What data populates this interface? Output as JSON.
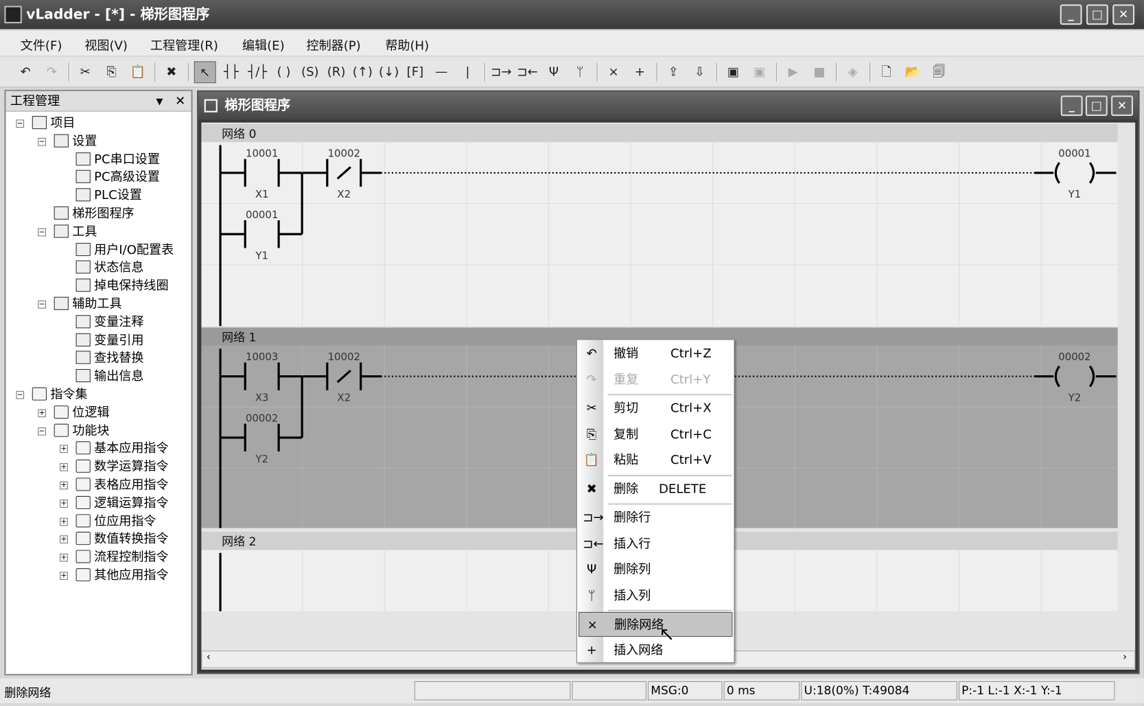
{
  "window": {
    "title": "vLadder - [*] - 梯形图程序",
    "min": "_",
    "max": "□",
    "close": "✕"
  },
  "menu": [
    "文件(F)",
    "视图(V)",
    "工程管理(R)",
    "编辑(E)",
    "控制器(P)",
    "帮助(H)"
  ],
  "toolbar": [
    {
      "name": "undo",
      "g": "↶"
    },
    {
      "name": "redo",
      "g": "↷",
      "dis": true
    },
    "sep",
    {
      "name": "cut",
      "g": "✂"
    },
    {
      "name": "copy",
      "g": "⎘"
    },
    {
      "name": "paste",
      "g": "📋"
    },
    "sep",
    {
      "name": "delete",
      "g": "✖"
    },
    "sep",
    {
      "name": "select",
      "g": "↖",
      "sel": true
    },
    {
      "name": "contact-no",
      "g": "┤├"
    },
    {
      "name": "contact-nc",
      "g": "┤/├"
    },
    {
      "name": "coil",
      "g": "( )"
    },
    {
      "name": "set-coil",
      "g": "(S)"
    },
    {
      "name": "reset-coil",
      "g": "(R)"
    },
    {
      "name": "pulse-up",
      "g": "(↑)"
    },
    {
      "name": "pulse-down",
      "g": "(↓)"
    },
    {
      "name": "function-block",
      "g": "[F]"
    },
    {
      "name": "horizontal-line",
      "g": "—"
    },
    {
      "name": "vertical-line",
      "g": "|"
    },
    "sep",
    {
      "name": "delete-row",
      "g": "⊐→"
    },
    {
      "name": "insert-row",
      "g": "⊐←"
    },
    {
      "name": "delete-column",
      "g": "Ψ"
    },
    {
      "name": "insert-column",
      "g": "ᛘ"
    },
    "sep",
    {
      "name": "delete-network",
      "g": "×"
    },
    {
      "name": "insert-network",
      "g": "+"
    },
    "sep",
    {
      "name": "upload",
      "g": "⇪"
    },
    {
      "name": "download",
      "g": "⇩"
    },
    "sep",
    {
      "name": "monitor",
      "g": "▣"
    },
    {
      "name": "monitor-off",
      "g": "▣",
      "dis": true
    },
    "sep",
    {
      "name": "run",
      "g": "▶",
      "dis": true
    },
    {
      "name": "stop",
      "g": "■",
      "dis": true
    },
    "sep",
    {
      "name": "diagnose",
      "g": "◈",
      "dis": true
    },
    "sep",
    {
      "name": "new",
      "g": "🗋"
    },
    {
      "name": "open",
      "g": "📂"
    },
    {
      "name": "save-all",
      "g": "🗐"
    }
  ],
  "sidebar": {
    "title": "工程管理",
    "items": [
      {
        "label": "项目",
        "lvl": 0,
        "exp": "-"
      },
      {
        "label": "设置",
        "lvl": 1,
        "exp": "-"
      },
      {
        "label": "PC串口设置",
        "lvl": 2
      },
      {
        "label": "PC高级设置",
        "lvl": 2
      },
      {
        "label": "PLC设置",
        "lvl": 2
      },
      {
        "label": "梯形图程序",
        "lvl": 1
      },
      {
        "label": "工具",
        "lvl": 1,
        "exp": "-"
      },
      {
        "label": "用户I/O配置表",
        "lvl": 2
      },
      {
        "label": "状态信息",
        "lvl": 2
      },
      {
        "label": "掉电保持线圈",
        "lvl": 2
      },
      {
        "label": "辅助工具",
        "lvl": 1,
        "exp": "-"
      },
      {
        "label": "变量注释",
        "lvl": 2
      },
      {
        "label": "变量引用",
        "lvl": 2
      },
      {
        "label": "查找替换",
        "lvl": 2
      },
      {
        "label": "输出信息",
        "lvl": 2
      },
      {
        "label": "指令集",
        "lvl": 0,
        "exp": "-",
        "folder": true
      },
      {
        "label": "位逻辑",
        "lvl": 1,
        "exp": "+",
        "folder": true
      },
      {
        "label": "功能块",
        "lvl": 1,
        "exp": "-",
        "folder": true
      },
      {
        "label": "基本应用指令",
        "lvl": 2,
        "exp": "+",
        "folder": true
      },
      {
        "label": "数学运算指令",
        "lvl": 2,
        "exp": "+",
        "folder": true
      },
      {
        "label": "表格应用指令",
        "lvl": 2,
        "exp": "+",
        "folder": true
      },
      {
        "label": "逻辑运算指令",
        "lvl": 2,
        "exp": "+",
        "folder": true
      },
      {
        "label": "位应用指令",
        "lvl": 2,
        "exp": "+",
        "folder": true
      },
      {
        "label": "数值转换指令",
        "lvl": 2,
        "exp": "+",
        "folder": true
      },
      {
        "label": "流程控制指令",
        "lvl": 2,
        "exp": "+",
        "folder": true
      },
      {
        "label": "其他应用指令",
        "lvl": 2,
        "exp": "+",
        "folder": true
      }
    ]
  },
  "editor": {
    "title": "梯形图程序",
    "networks": [
      {
        "label": "网络 0",
        "selected": false,
        "contacts": [
          {
            "addr": "10001",
            "tag": "X1",
            "type": "no",
            "row": 0,
            "col": 0
          },
          {
            "addr": "10002",
            "tag": "X2",
            "type": "nc",
            "row": 0,
            "col": 1
          },
          {
            "addr": "00001",
            "tag": "Y1",
            "type": "no",
            "row": 1,
            "col": 0
          }
        ],
        "coil": {
          "addr": "00001",
          "tag": "Y1"
        }
      },
      {
        "label": "网络 1",
        "selected": true,
        "contacts": [
          {
            "addr": "10003",
            "tag": "X3",
            "type": "no",
            "row": 0,
            "col": 0
          },
          {
            "addr": "10002",
            "tag": "X2",
            "type": "nc",
            "row": 0,
            "col": 1
          },
          {
            "addr": "00002",
            "tag": "Y2",
            "type": "no",
            "row": 1,
            "col": 0
          }
        ],
        "coil": {
          "addr": "00002",
          "tag": "Y2"
        }
      },
      {
        "label": "网络 2",
        "selected": false,
        "contacts": [],
        "coil": null
      }
    ]
  },
  "context_menu": [
    {
      "icon": "undo",
      "g": "↶",
      "label": "撤销",
      "sc": "Ctrl+Z"
    },
    {
      "icon": "redo",
      "g": "↷",
      "label": "重复",
      "sc": "Ctrl+Y",
      "dis": true
    },
    "sep",
    {
      "icon": "cut",
      "g": "✂",
      "label": "剪切",
      "sc": "Ctrl+X"
    },
    {
      "icon": "copy",
      "g": "⎘",
      "label": "复制",
      "sc": "Ctrl+C"
    },
    {
      "icon": "paste",
      "g": "📋",
      "label": "粘贴",
      "sc": "Ctrl+V"
    },
    "sep",
    {
      "icon": "delete",
      "g": "✖",
      "label": "删除",
      "sc": "DELETE"
    },
    "sep",
    {
      "icon": "delete-row",
      "g": "⊐→",
      "label": "删除行"
    },
    {
      "icon": "insert-row",
      "g": "⊐←",
      "label": "插入行"
    },
    {
      "icon": "delete-column",
      "g": "Ψ",
      "label": "删除列"
    },
    {
      "icon": "insert-column",
      "g": "ᛘ",
      "label": "插入列"
    },
    "sep",
    {
      "icon": "delete-network",
      "g": "×",
      "label": "删除网络",
      "hl": true
    },
    {
      "icon": "insert-network",
      "g": "+",
      "label": "插入网络"
    }
  ],
  "status": {
    "message": "删除网络",
    "msg": "MSG:0",
    "time": "0 ms",
    "usage": "U:18(0%) T:49084",
    "pos": "P:-1 L:-1 X:-1 Y:-1"
  }
}
